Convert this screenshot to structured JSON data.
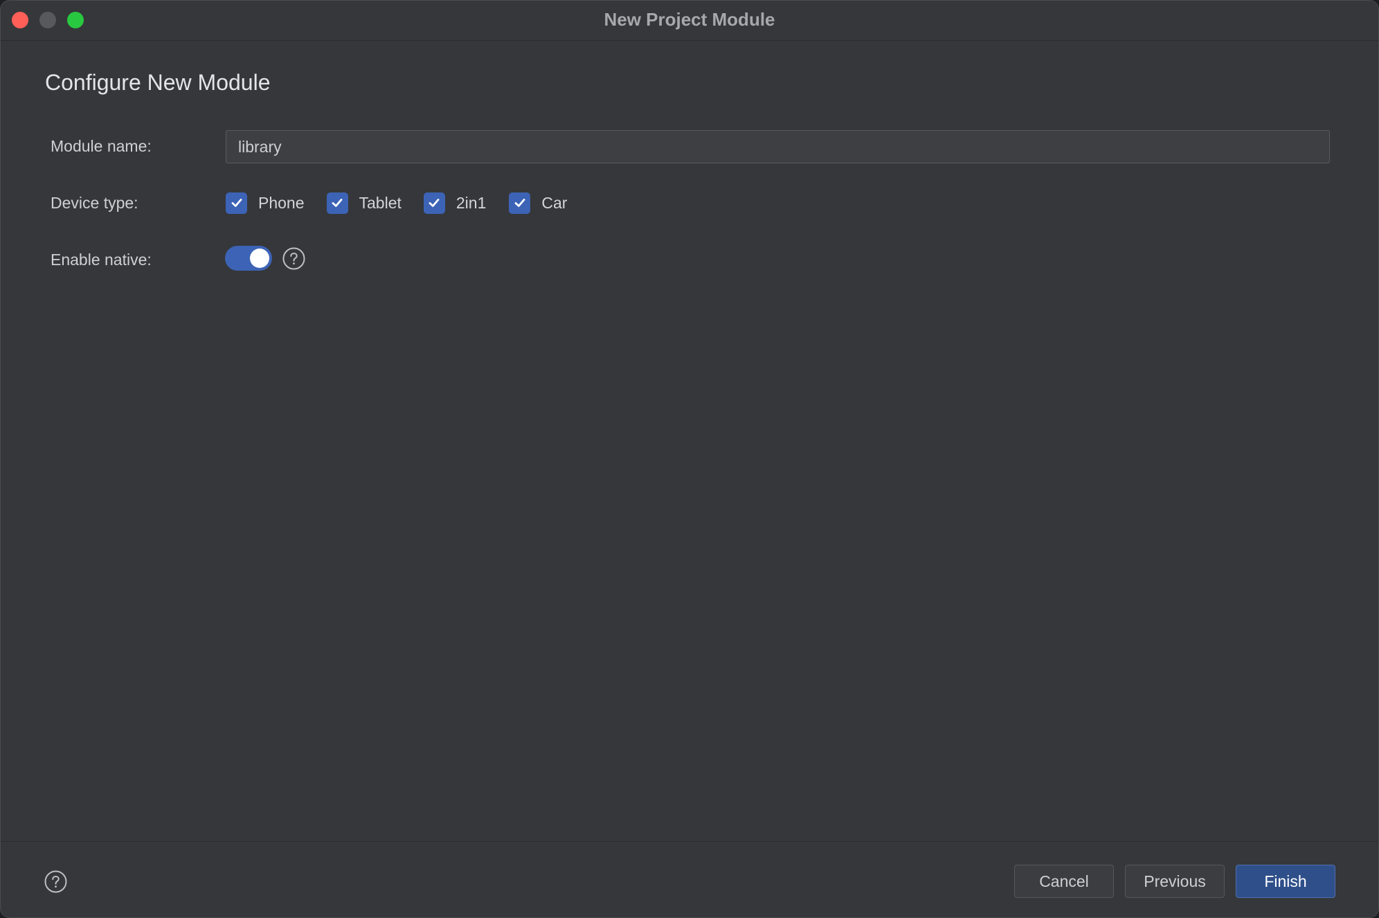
{
  "window": {
    "title": "New Project Module"
  },
  "content": {
    "heading": "Configure New Module",
    "module_name": {
      "label": "Module name:",
      "value": "library"
    },
    "device_type": {
      "label": "Device type:",
      "options": [
        {
          "label": "Phone",
          "checked": true
        },
        {
          "label": "Tablet",
          "checked": true
        },
        {
          "label": "2in1",
          "checked": true
        },
        {
          "label": "Car",
          "checked": true
        }
      ]
    },
    "enable_native": {
      "label": "Enable native:",
      "enabled": true
    }
  },
  "footer": {
    "cancel_label": "Cancel",
    "previous_label": "Previous",
    "finish_label": "Finish"
  },
  "colors": {
    "accent": "#3c63b5",
    "window_bg": "#36373a",
    "primary_button": "#2f4f8a",
    "close": "#ff5f57",
    "minimize": "#58595c",
    "zoom": "#28c840"
  },
  "icons": {
    "checkmark": "checkmark-icon",
    "help": "help-icon"
  }
}
